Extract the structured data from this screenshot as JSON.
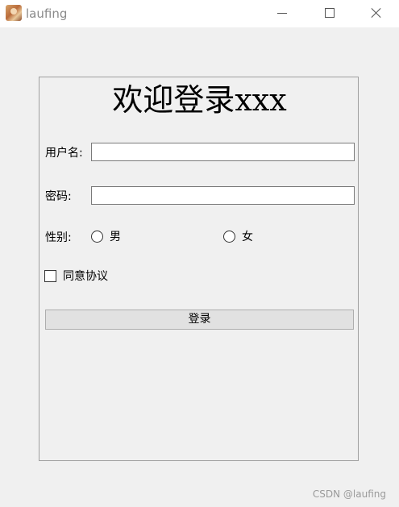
{
  "window": {
    "title": "laufing",
    "icon": "avatar-app-icon"
  },
  "form": {
    "heading": "欢迎登录xxx",
    "username_label": "用户名:",
    "username_value": "",
    "password_label": "密码:",
    "password_value": "",
    "gender_label": "性别:",
    "gender_options": [
      {
        "label": "男",
        "selected": false
      },
      {
        "label": "女",
        "selected": false
      }
    ],
    "agree_label": "同意协议",
    "agree_checked": false,
    "login_button": "登录"
  },
  "watermark": "CSDN @laufing",
  "colors": {
    "background": "#f0f0f0",
    "titlebar": "#ffffff",
    "button": "#e1e1e1",
    "frame_border": "#a0a0a0"
  }
}
